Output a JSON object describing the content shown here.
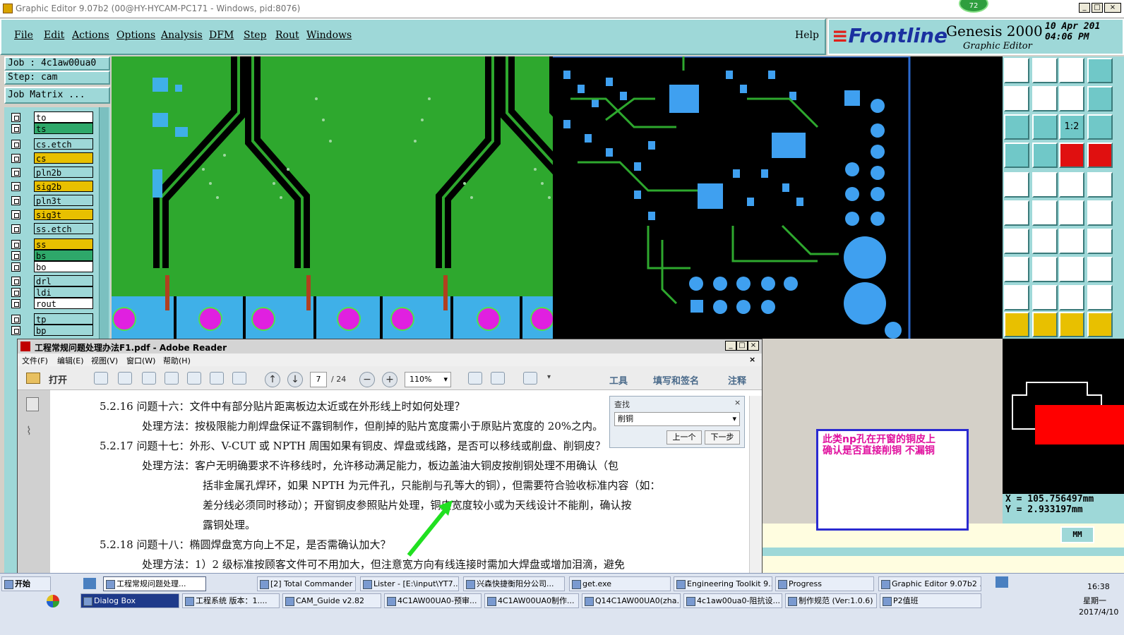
{
  "window": {
    "title": "Graphic Editor 9.07b2 (00@HY-HYCAM-PC171 - Windows, pid:8076)",
    "badge": "72"
  },
  "menu": [
    "File",
    "Edit",
    "Actions",
    "Options",
    "Analysis",
    "DFM",
    "Step",
    "Rout",
    "Windows"
  ],
  "help": "Help",
  "brand": {
    "logo": "Frontline",
    "product": "Genesis 2000",
    "subtitle": "Graphic Editor",
    "date": "10 Apr 201",
    "time": "04:06 PM"
  },
  "job": {
    "job": "Job : 4c1aw00ua0",
    "step": "Step: cam",
    "matrix": "Job Matrix ..."
  },
  "layers": [
    {
      "name": "to",
      "color": "#ffffff"
    },
    {
      "name": "ts",
      "color": "#2ea86a"
    },
    {
      "name": "cs.etch",
      "color": "#9ed8d8"
    },
    {
      "name": "cs",
      "color": "#e8c000"
    },
    {
      "name": "pln2b",
      "color": "#9ed8d8"
    },
    {
      "name": "sig2b",
      "color": "#e8c000"
    },
    {
      "name": "pln3t",
      "color": "#9ed8d8"
    },
    {
      "name": "sig3t",
      "color": "#e8c000"
    },
    {
      "name": "ss.etch",
      "color": "#9ed8d8"
    },
    {
      "name": "ss",
      "color": "#e8c000"
    },
    {
      "name": "bs",
      "color": "#2ea86a"
    },
    {
      "name": "bo",
      "color": "#ffffff"
    },
    {
      "name": "drl",
      "color": "#9ed8d8"
    },
    {
      "name": "ldi",
      "color": "#9ed8d8"
    },
    {
      "name": "rout",
      "color": "#ffffff"
    },
    {
      "name": "tp",
      "color": "#9ed8d8"
    },
    {
      "name": "bp",
      "color": "#9ed8d8"
    }
  ],
  "coords": {
    "x": "X = 105.756497mm",
    "y": "Y = 2.933197mm"
  },
  "unit": "MM",
  "reader": {
    "title": "工程常规问题处理办法F1.pdf - Adobe Reader",
    "menu": [
      "文件(F)",
      "编辑(E)",
      "视图(V)",
      "窗口(W)",
      "帮助(H)"
    ],
    "open": "打开",
    "page": "7",
    "pages": "/ 24",
    "zoom": "110%",
    "tools": "工具",
    "fill_sign": "填写和签名",
    "comment": "注释",
    "find_title": "查找",
    "find_value": "削铜",
    "prev": "上一个",
    "next": "下一步",
    "lines": [
      "5.2.16  问题十六：文件中有部分贴片距离板边太近或在外形线上时如何处理？",
      "处理方法：按极限能力削焊盘保证不露铜制作，但削掉的贴片宽度需小于原贴片宽度的 20%之内。",
      "5.2.17  问题十七：外形、V-CUT 或 NPTH 周围如果有铜皮、焊盘或线路，是否可以移线或削盘、削铜皮？",
      "处理方法：客户无明确要求不许移线时，允许移动满足能力，板边盖油大铜皮按削铜处理不用确认（包",
      "括非金属孔焊环，如果 NPTH 为元件孔，只能削与孔等大的铜），但需要符合验收标准内容（如：",
      "差分线必须同时移动）；开窗铜皮参照贴片处理，铜皮宽度较小或为天线设计不能削，确认按",
      "露铜处理。",
      "5.2.18  问题十八：椭圆焊盘宽方向上不足，是否需确认加大？",
      "处理方法：1）2 级标准按顾客文件可不用加大，但注意宽方向有线连接时需加大焊盘或增加泪滴，避免"
    ]
  },
  "annotation": {
    "line1": "此类np孔在开窗的铜皮上",
    "line2": "确认是否直接削铜   不漏铜"
  },
  "taskbar": {
    "start": "开始",
    "row1": [
      "工程常规问题处理...",
      "[2] Total Commander ...",
      "Lister - [E:\\input\\YT7....",
      "兴森快捷衡阳分公司...",
      "get.exe",
      "Engineering Toolkit 9....",
      "Progress",
      "Graphic Editor 9.07b2 ..."
    ],
    "row2": [
      "Dialog Box",
      "工程系统  版本：1....",
      "CAM_Guide v2.82",
      "4C1AW00UA0-预审...",
      "4C1AW00UA0制作...",
      "Q14C1AW00UA0(zha...",
      "4c1aw00ua0-阻抗设...",
      "制作规范 (Ver:1.0.6)",
      "P2值班"
    ],
    "time": "16:38",
    "weekday": "星期一",
    "date": "2017/4/10"
  }
}
